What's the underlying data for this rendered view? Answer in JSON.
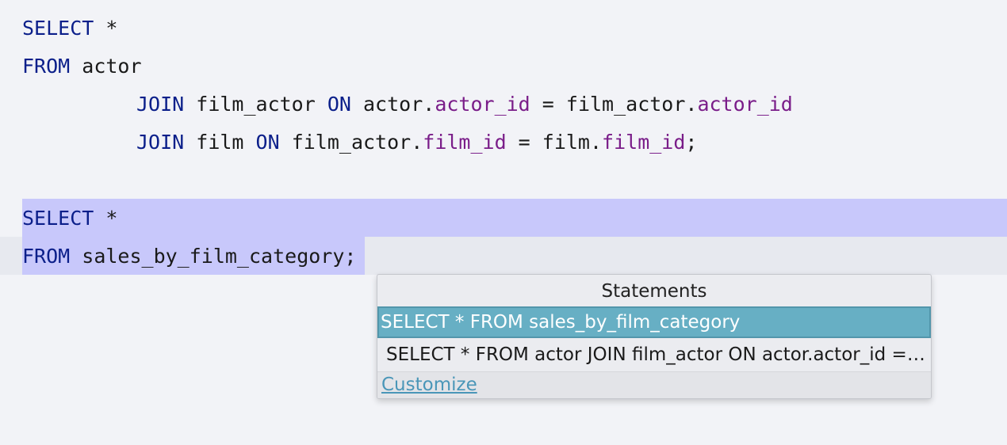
{
  "editor": {
    "lines": [
      {
        "tokens": [
          {
            "text": "SELECT",
            "kind": "kw"
          },
          {
            "text": " *",
            "kind": "plain"
          }
        ]
      },
      {
        "tokens": [
          {
            "text": "FROM",
            "kind": "kw"
          },
          {
            "text": " actor",
            "kind": "plain"
          }
        ]
      },
      {
        "tokens": [
          {
            "text": "JOIN",
            "kind": "kw"
          },
          {
            "text": " film_actor ",
            "kind": "plain"
          },
          {
            "text": "ON",
            "kind": "kw"
          },
          {
            "text": " actor.",
            "kind": "plain"
          },
          {
            "text": "actor_id",
            "kind": "col"
          },
          {
            "text": " = film_actor.",
            "kind": "plain"
          },
          {
            "text": "actor_id",
            "kind": "col"
          }
        ]
      },
      {
        "tokens": [
          {
            "text": "JOIN",
            "kind": "kw"
          },
          {
            "text": " film ",
            "kind": "plain"
          },
          {
            "text": "ON",
            "kind": "kw"
          },
          {
            "text": " film_actor.",
            "kind": "plain"
          },
          {
            "text": "film_id",
            "kind": "col"
          },
          {
            "text": " = film.",
            "kind": "plain"
          },
          {
            "text": "film_id",
            "kind": "col"
          },
          {
            "text": ";",
            "kind": "plain"
          }
        ]
      },
      {
        "tokens": []
      },
      {
        "tokens": [
          {
            "text": "SELECT",
            "kind": "kw"
          },
          {
            "text": " *",
            "kind": "plain"
          }
        ]
      },
      {
        "tokens": [
          {
            "text": "FROM",
            "kind": "kw"
          },
          {
            "text": " sales_by_film_category;",
            "kind": "plain"
          }
        ]
      }
    ]
  },
  "popup": {
    "title": "Statements",
    "items": [
      {
        "label": "SELECT * FROM sales_by_film_category",
        "selected": true
      },
      {
        "label": "SELECT * FROM actor JOIN film_actor ON actor.actor_id = film_actor.actor_id JOIN film ON film_actor.film_id = film.film_id",
        "selected": false
      }
    ],
    "footer_link": "Customize"
  },
  "colors": {
    "keyword": "#0b1f8a",
    "column": "#7a1d89",
    "selection": "#c8c8fb",
    "selected_item": "#67afc4",
    "link": "#4a96b8"
  }
}
